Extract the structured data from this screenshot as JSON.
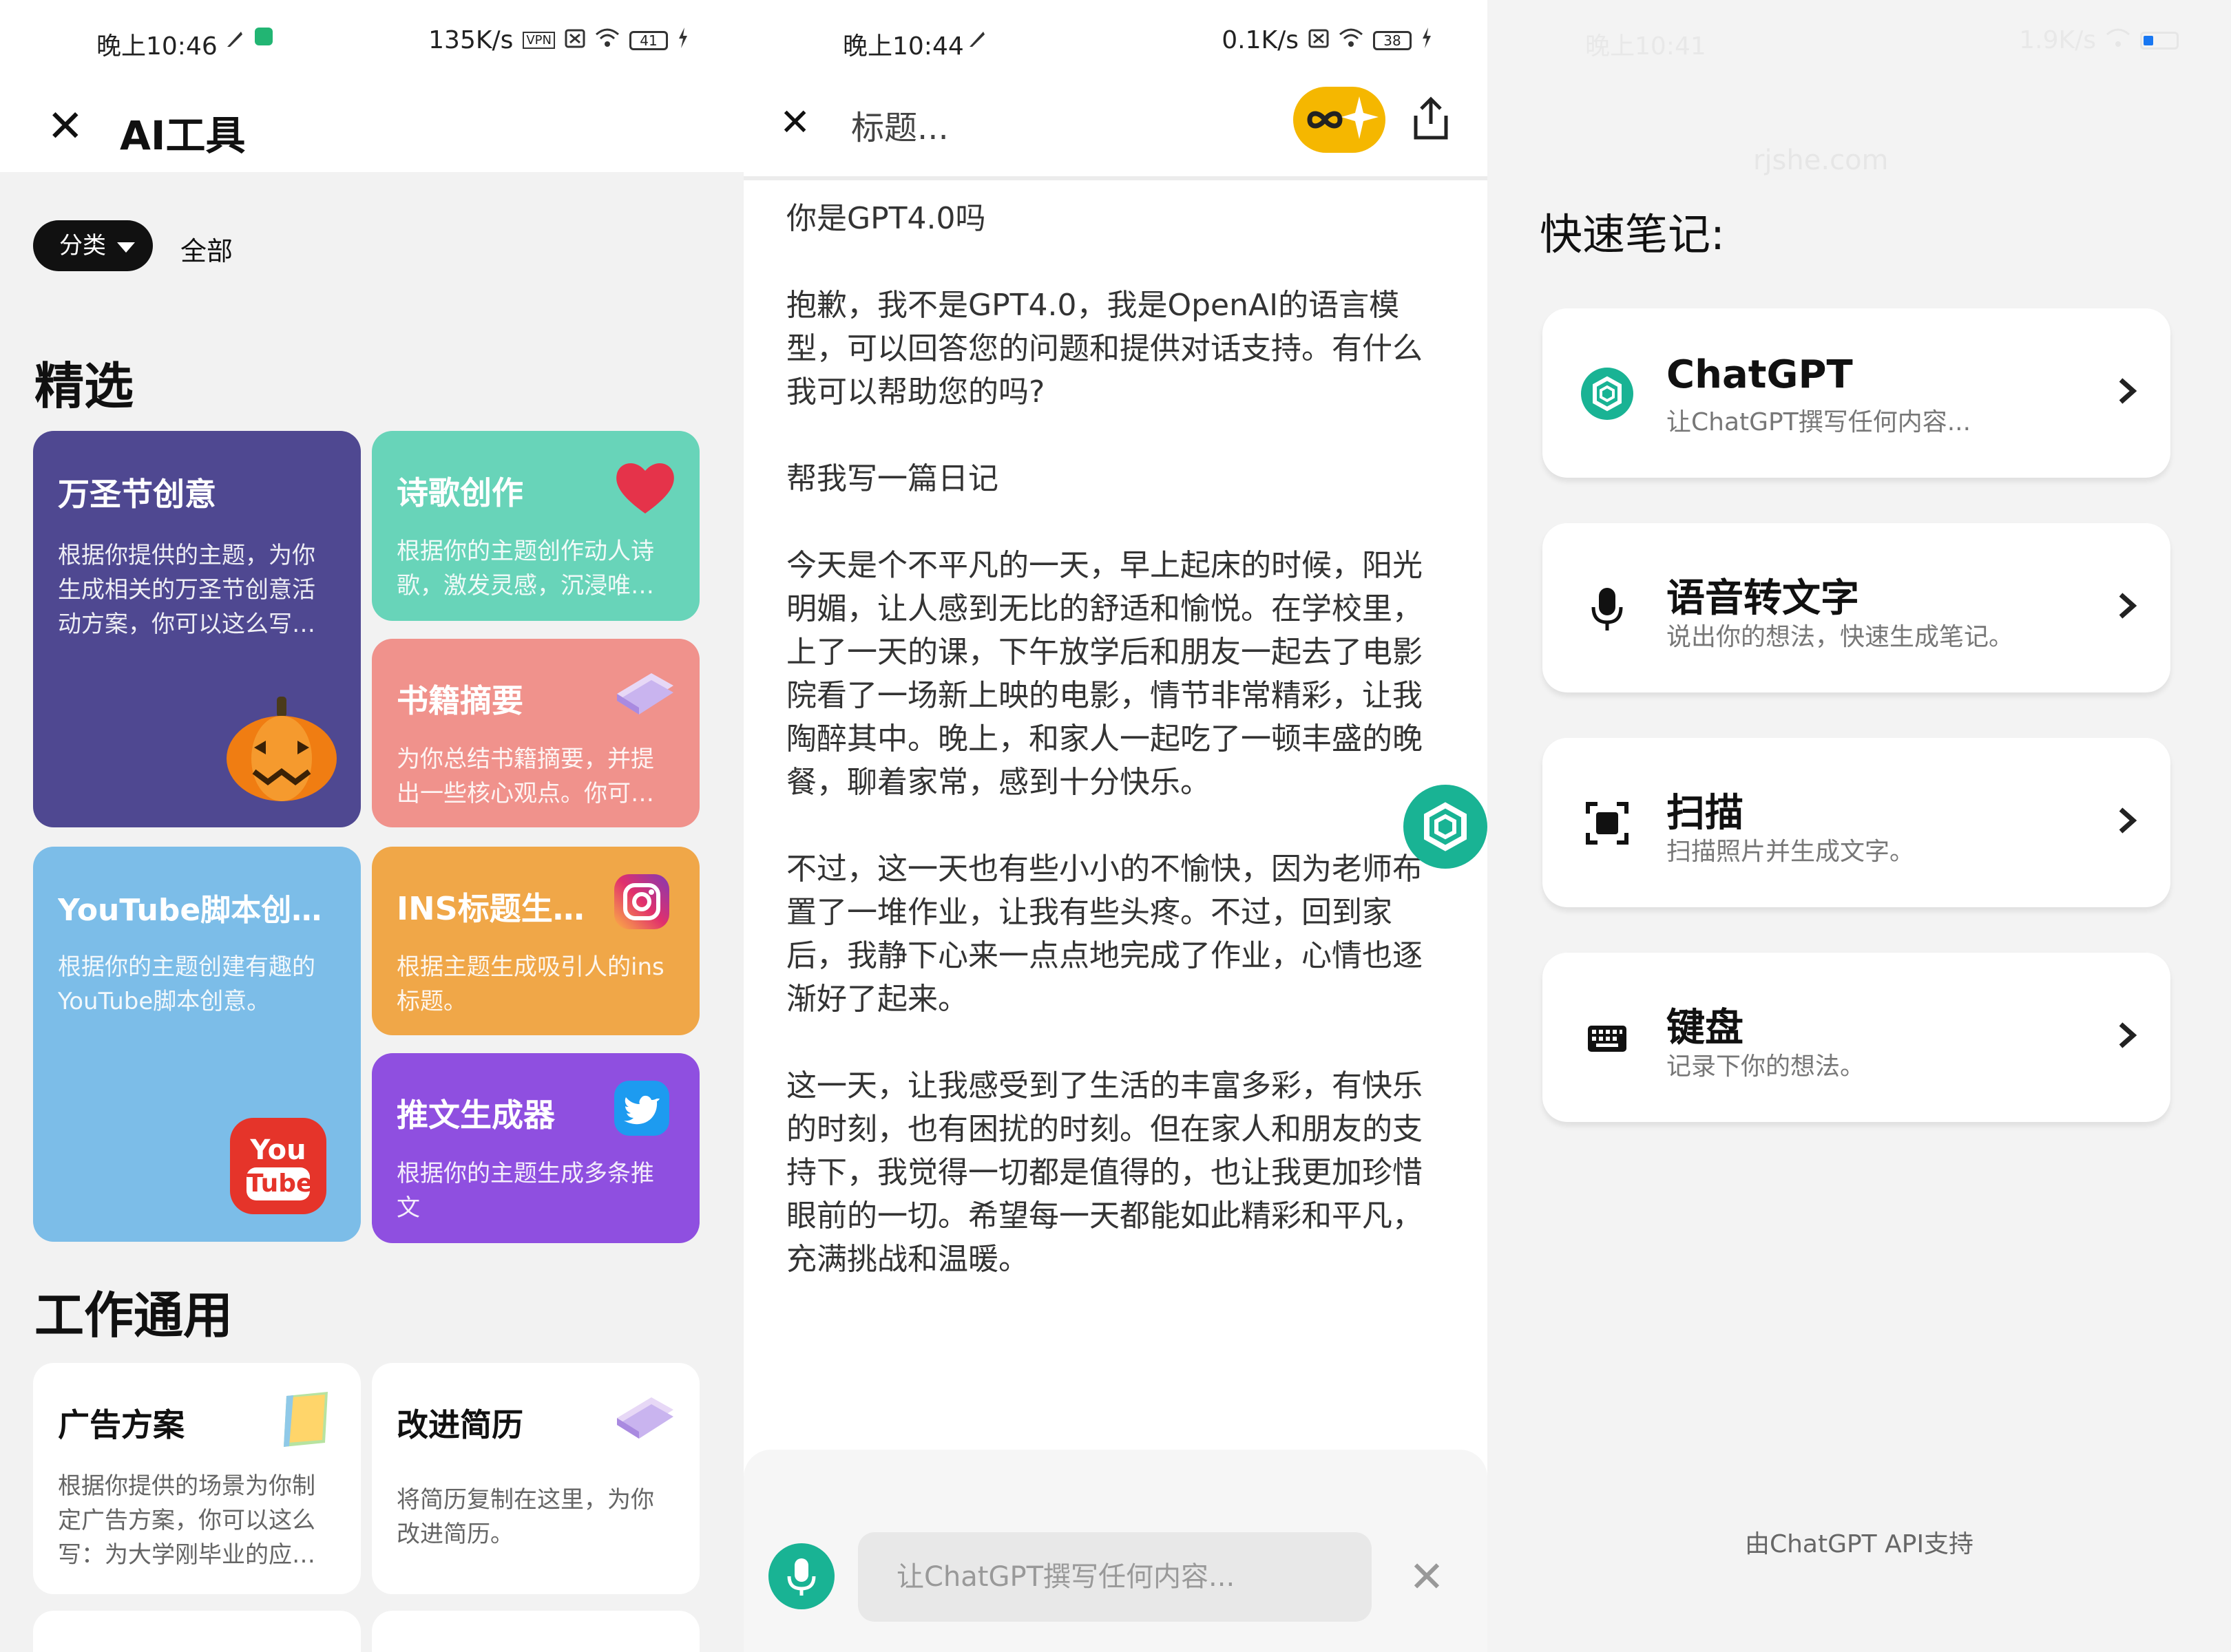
{
  "panel1": {
    "status": {
      "time": "晚上10:46",
      "speed": "135K/s",
      "vpn": "VPN",
      "battery": "41"
    },
    "title": "AI工具",
    "category_label": "分类",
    "all_label": "全部",
    "section_featured": "精选",
    "section_work": "工作通用",
    "featured": [
      {
        "title": "万圣节创意",
        "desc": "根据你提供的主题，为你生成相关的万圣节创意活动方案，你可以这么写…",
        "color": "#4f4891"
      },
      {
        "title": "诗歌创作",
        "desc": "根据你的主题创作动人诗歌，激发灵感，沉浸唯…",
        "color": "#68d4b9"
      },
      {
        "title": "书籍摘要",
        "desc": "为你总结书籍摘要，并提出一些核心观点。你可…",
        "color": "#f0928c"
      },
      {
        "title": "YouTube脚本创作器",
        "desc": "根据你的主题创建有趣的YouTube脚本创意。",
        "color": "#7cbde8"
      },
      {
        "title": "INS标题生成…",
        "desc": "根据主题生成吸引人的ins标题。",
        "color": "#f0a748"
      },
      {
        "title": "推文生成器",
        "desc": "根据你的主题生成多条推文",
        "color": "#8f4fe0"
      }
    ],
    "youtube_logo": {
      "you": "You",
      "tube": "Tube"
    },
    "work": [
      {
        "title": "广告方案",
        "desc": "根据你提供的场景为你制定广告方案，你可以这么写：为大学刚毕业的应…"
      },
      {
        "title": "改进简历",
        "desc": "将简历复制在这里，为你改进简历。"
      }
    ]
  },
  "panel2": {
    "status": {
      "time": "晚上10:44",
      "speed": "0.1K/s",
      "battery": "38"
    },
    "title": "标题...",
    "messages": [
      "你是GPT4.0吗",
      "抱歉，我不是GPT4.0，我是OpenAI的语言模型，可以回答您的问题和提供对话支持。有什么我可以帮助您的吗?",
      "帮我写一篇日记",
      "今天是个不平凡的一天，早上起床的时候，阳光明媚，让人感到无比的舒适和愉悦。在学校里，上了一天的课，下午放学后和朋友一起去了电影院看了一场新上映的电影，情节非常精彩，让我陶醉其中。晚上，和家人一起吃了一顿丰盛的晚餐，聊着家常，感到十分快乐。",
      "不过，这一天也有些小小的不愉快，因为老师布置了一堆作业，让我有些头疼。不过，回到家后，我静下心来一点点地完成了作业，心情也逐渐好了起来。",
      "这一天，让我感受到了生活的丰富多彩，有快乐的时刻，也有困扰的时刻。但在家人和朋友的支持下，我觉得一切都是值得的，也让我更加珍惜眼前的一切。希望每一天都能如此精彩和平凡，充满挑战和温暖。"
    ],
    "input_placeholder": "让ChatGPT撰写任何内容..."
  },
  "panel3": {
    "status": {
      "time": "晚上10:41",
      "speed": "1.9K/s"
    },
    "watermark": "rjshe.com",
    "title": "快速笔记:",
    "items": [
      {
        "title": "ChatGPT",
        "desc": "让ChatGPT撰写任何内容..."
      },
      {
        "title": "语音转文字",
        "desc": "说出你的想法，快速生成笔记。"
      },
      {
        "title": "扫描",
        "desc": "扫描照片并生成文字。"
      },
      {
        "title": "键盘",
        "desc": "记录下你的想法。"
      }
    ],
    "footer": "由ChatGPT API支持"
  }
}
